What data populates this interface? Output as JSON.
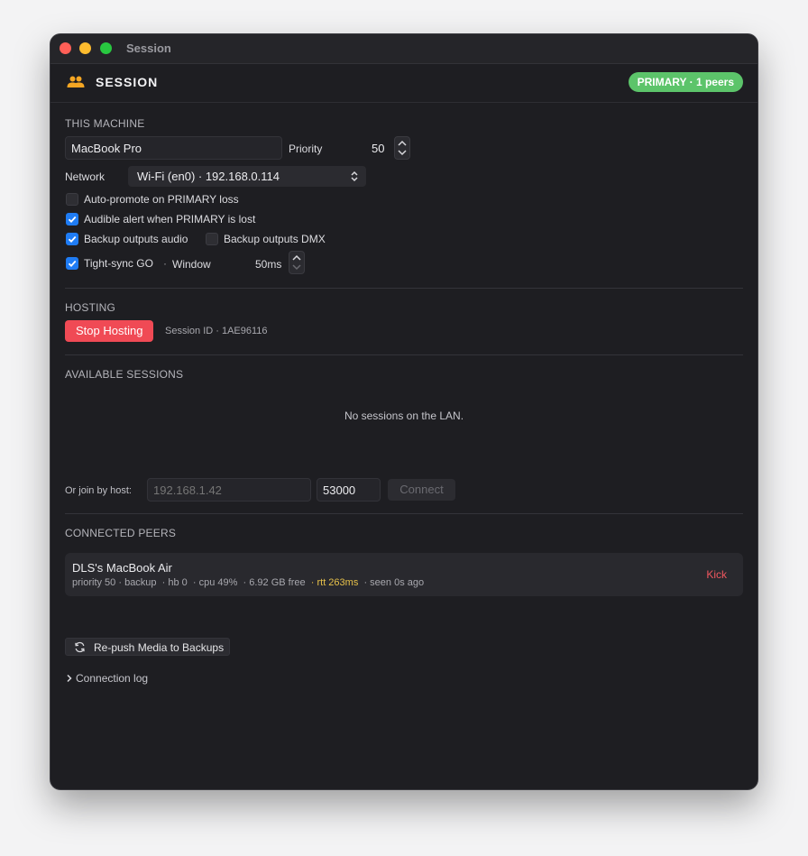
{
  "window": {
    "title": "Session"
  },
  "header": {
    "title": "SESSION",
    "badge": "PRIMARY · 1 peers"
  },
  "this_machine": {
    "title": "THIS MACHINE",
    "name_value": "MacBook Pro",
    "priority_label": "Priority",
    "priority_value": "50",
    "network_label": "Network",
    "network_value": "Wi-Fi (en0) · 192.168.0.114",
    "opt_autopromote": "Auto-promote on PRIMARY loss",
    "opt_audible": "Audible alert when PRIMARY is lost",
    "opt_backup_audio": "Backup outputs audio",
    "opt_backup_dmx": "Backup outputs DMX",
    "opt_tightsync": "Tight-sync GO",
    "separator": "·",
    "window_label": "Window",
    "window_value": "50ms"
  },
  "hosting": {
    "title": "HOSTING",
    "stop_label": "Stop Hosting",
    "session_id": "Session ID · 1AE96116"
  },
  "available": {
    "title": "AVAILABLE SESSIONS",
    "empty": "No sessions on the LAN.",
    "join_label": "Or join by host:",
    "host_placeholder": "192.168.1.42",
    "port_value": "53000",
    "connect_label": "Connect"
  },
  "peers": {
    "title": "CONNECTED PEERS",
    "items": [
      {
        "name": "DLS's MacBook Air",
        "meta": "priority 50 · backup  · hb 0  · cpu 49%  · 6.92 GB free",
        "rtt": "· rtt 263ms",
        "seen": "· seen 0s ago",
        "kick": "Kick"
      }
    ]
  },
  "actions": {
    "repush_label": "Re-push Media to Backups",
    "log_label": "Connection log"
  },
  "colors": {
    "accent_blue": "#1f7cf4",
    "primary_badge": "#5cc46a",
    "stop_red": "#f04a55",
    "kick_red": "#f0575f",
    "rtt_yellow": "#e6c04a",
    "icon_orange": "#f5a623"
  },
  "icons": {
    "session": "people-icon",
    "checkbox": "checkmark-icon",
    "repush": "refresh-icon",
    "disclosure": "chevron-right-icon"
  }
}
